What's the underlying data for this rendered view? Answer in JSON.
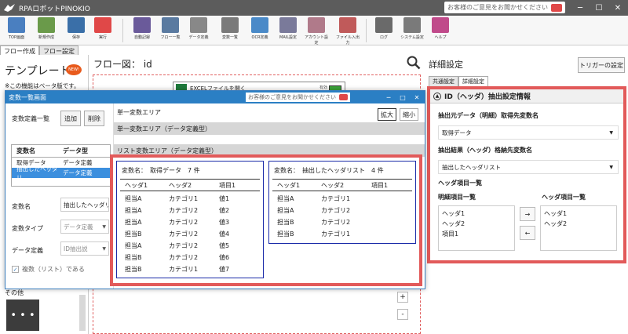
{
  "app": {
    "title": "RPAロボットPINOKIO",
    "feedback": "お客様のご意見をお聞かせください",
    "window_buttons": [
      "─",
      "☐",
      "✕"
    ]
  },
  "toolbar": [
    {
      "label": "TOP画面",
      "color": "#4a7fc0"
    },
    {
      "label": "新規作成",
      "color": "#6a9a4a"
    },
    {
      "label": "保存",
      "color": "#3a6fa8"
    },
    {
      "label": "実行",
      "color": "#e04848"
    },
    {
      "label": "自動記録",
      "color": "#6a5a9a"
    },
    {
      "label": "フロー一覧",
      "color": "#5a7aa0"
    },
    {
      "label": "データ定義",
      "color": "#888888"
    },
    {
      "label": "変数一覧",
      "color": "#7a7a7a"
    },
    {
      "label": "OCR定義",
      "color": "#4a8ac8"
    },
    {
      "label": "MAIL設定",
      "color": "#7a7a9a"
    },
    {
      "label": "アカウント設定",
      "color": "#b07a8a"
    },
    {
      "label": "ファイル入出力",
      "color": "#c05a5a"
    },
    {
      "label": "ログ",
      "color": "#6a6a6a"
    },
    {
      "label": "システム設定",
      "color": "#7a7a7a"
    },
    {
      "label": "ヘルプ",
      "color": "#c04a8a"
    }
  ],
  "left": {
    "tabs": [
      "フロー作成",
      "フロー設定"
    ],
    "template_title": "テンプレート",
    "new_badge": "NEW!",
    "beta_note": "※この機能はベータ版です。",
    "other_label": "その他",
    "tile_dots": "• • •",
    "tile_label": "その他"
  },
  "flow": {
    "title": "フロー図： id",
    "node_label": "EXCELファイルを開く",
    "node_toggle": "有効",
    "zoom_in": "+",
    "zoom_out": "-"
  },
  "right": {
    "title": "詳細設定",
    "trigger_button": "トリガーの設定",
    "tabs": [
      "共通設定",
      "詳細設定"
    ],
    "section_title": "ID（ヘッダ）抽出設定情報",
    "source_label": "抽出元データ（明細）取得先変数名",
    "source_value": "取得データ",
    "dest_label": "抽出結果（ヘッダ）格納先変数名",
    "dest_value": "抽出したヘッダリスト",
    "header_items_label": "ヘッダ項目一覧",
    "detail_list_label": "明細項目一覧",
    "detail_items": [
      "ヘッダ1",
      "ヘッダ2",
      "項目1"
    ],
    "header_list_label": "ヘッダ項目一覧",
    "header_items": [
      "ヘッダ1",
      "ヘッダ2"
    ],
    "arrow_right": "→",
    "arrow_left": "←"
  },
  "dialog": {
    "title": "変数一覧画面",
    "feedback": "お客様のご意見をお聞かせください",
    "window_buttons": [
      "─",
      "□",
      "✕"
    ],
    "list_label": "変数定義一覧",
    "add_button": "追加",
    "delete_button": "削除",
    "table_headers": [
      "変数名",
      "データ型"
    ],
    "rows": [
      {
        "name": "取得データ",
        "type": "データ定義"
      },
      {
        "name": "抽出したヘッダリ",
        "type": "データ定義"
      }
    ],
    "var_name_label": "変数名",
    "var_name_value": "抽出したヘッダリ",
    "var_type_label": "変数タイプ",
    "var_type_value": "データ定義",
    "data_def_label": "データ定義",
    "data_def_value": "ID抽出説",
    "multiple_label": "複数（リスト）である",
    "single_area": "単一変数エリア",
    "single_area_dd": "単一変数エリア（データ定義型）",
    "list_area": "リスト変数エリア（データ定義型）",
    "zoom_in": "拡大",
    "zoom_out": "縮小"
  },
  "boxes": [
    {
      "prefix": "変数名：",
      "name": "取得データ",
      "count": "7 件",
      "headers": [
        "ヘッダ1",
        "ヘッダ2",
        "項目1"
      ],
      "rows": [
        [
          "担当A",
          "カテゴリ1",
          "値1"
        ],
        [
          "担当A",
          "カテゴリ2",
          "値2"
        ],
        [
          "担当A",
          "カテゴリ2",
          "値3"
        ],
        [
          "担当B",
          "カテゴリ2",
          "値4"
        ],
        [
          "担当A",
          "カテゴリ2",
          "値5"
        ],
        [
          "担当B",
          "カテゴリ2",
          "値6"
        ],
        [
          "担当B",
          "カテゴリ1",
          "値7"
        ]
      ]
    },
    {
      "prefix": "変数名：",
      "name": "抽出したヘッダリスト",
      "count": "4 件",
      "headers": [
        "ヘッダ1",
        "ヘッダ2",
        "項目1"
      ],
      "rows": [
        [
          "担当A",
          "カテゴリ1",
          ""
        ],
        [
          "担当A",
          "カテゴリ2",
          ""
        ],
        [
          "担当B",
          "カテゴリ2",
          ""
        ],
        [
          "担当B",
          "カテゴリ1",
          ""
        ]
      ]
    }
  ]
}
